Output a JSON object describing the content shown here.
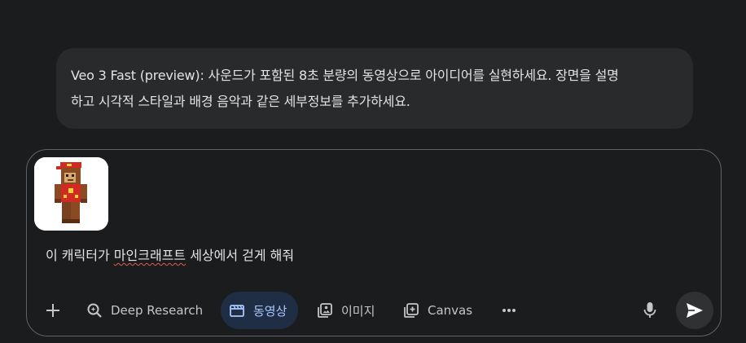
{
  "info": {
    "line1": "Veo 3 Fast (preview): 사운드가 포함된 8초 분량의 동영상으로 아이디어를 실현하세요. 장면을 설명",
    "line2": "하고 시각적 스타일과 배경 음악과 같은 세부정보를 추가하세요."
  },
  "composer": {
    "prompt_part1": "이 캐릭터가 ",
    "prompt_misspelled": "마인크래프트",
    "prompt_part2": " 세상에서 걷게 해줘",
    "attachment_icon": "minecraft-character-image"
  },
  "toolbar": {
    "add_icon": "plus-icon",
    "deep_research_label": "Deep Research",
    "video_label": "동영상",
    "image_label": "이미지",
    "canvas_label": "Canvas",
    "more_icon": "more-horiz-icon",
    "mic_icon": "mic-icon",
    "send_icon": "send-icon"
  },
  "colors": {
    "background": "#1b1c1d",
    "bubble": "#282a2c",
    "active_chip_bg": "#1f2e45",
    "active_chip_text": "#a8c7fa",
    "text": "#e3e3e3",
    "muted_text": "#c4c7c5"
  }
}
